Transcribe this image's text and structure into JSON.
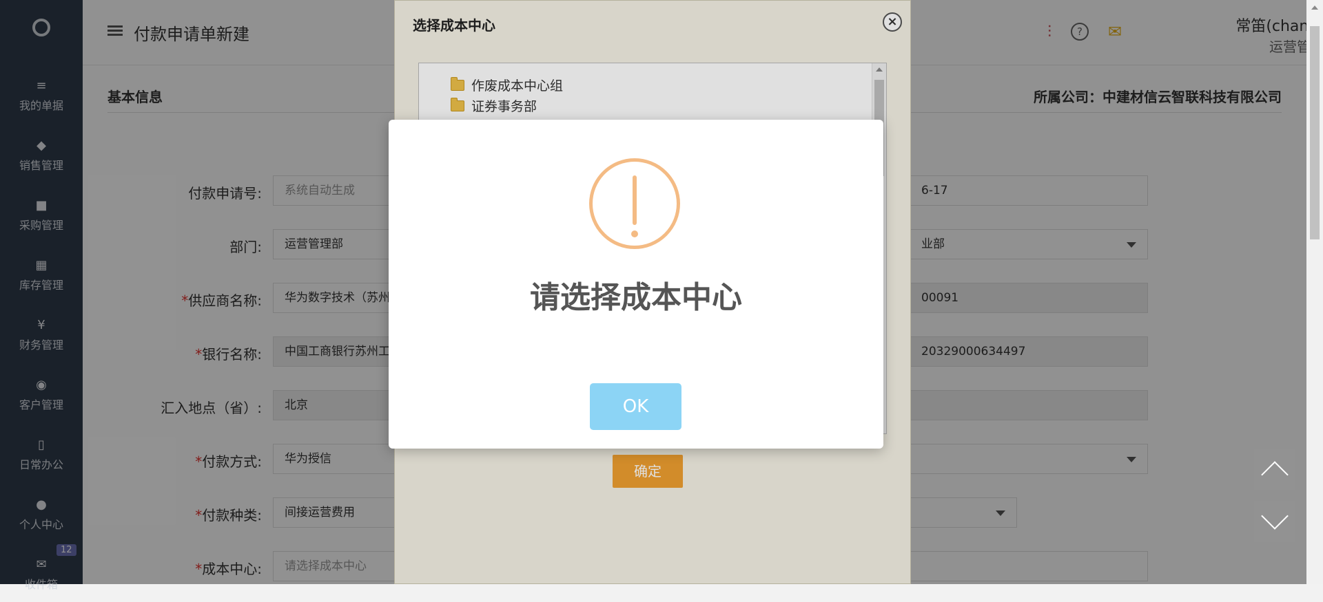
{
  "sidebar": {
    "items": [
      {
        "label": "我的单据",
        "icon": "documents-icon"
      },
      {
        "label": "销售管理",
        "icon": "tag-icon"
      },
      {
        "label": "采购管理",
        "icon": "truck-icon"
      },
      {
        "label": "库存管理",
        "icon": "grid-icon"
      },
      {
        "label": "财务管理",
        "icon": "yen-icon"
      },
      {
        "label": "客户管理",
        "icon": "target-icon"
      },
      {
        "label": "日常办公",
        "icon": "office-icon"
      },
      {
        "label": "个人中心",
        "icon": "user-icon"
      },
      {
        "label": "收件箱",
        "icon": "mail-icon"
      }
    ],
    "inbox_badge": "12"
  },
  "header": {
    "title": "付款申请单新建",
    "user_name": "常笛(changdi)",
    "user_dept": "运营管理部"
  },
  "form": {
    "section_title": "基本信息",
    "company": "所属公司：中建材信云智联科技有限公司",
    "rows": [
      {
        "label": "付款申请号:",
        "required": false,
        "left_value": "系统自动生成",
        "right_value": "6-17"
      },
      {
        "label": "部门:",
        "required": false,
        "left_value": "运营管理部",
        "right_value": "业部"
      },
      {
        "label": "供应商名称:",
        "required": true,
        "left_value": "华为数字技术（苏州",
        "right_value": "00091"
      },
      {
        "label": "银行名称:",
        "required": true,
        "left_value": "中国工商银行苏州工",
        "right_value": "20329000634497"
      },
      {
        "label": "汇入地点（省）:",
        "required": false,
        "left_value": "北京",
        "right_value": ""
      },
      {
        "label": "付款方式:",
        "required": true,
        "left_value": "华为授信",
        "right_value": ""
      },
      {
        "label": "付款种类:",
        "required": true,
        "left_value": "间接运营费用",
        "right_value": ""
      },
      {
        "label": "成本中心:",
        "required": true,
        "left_value": "请选择成本中心",
        "right_value": ""
      }
    ]
  },
  "dialog": {
    "title": "选择成本中心",
    "tree_items": [
      "作废成本中心组",
      "证券事务部"
    ],
    "confirm_label": "确定"
  },
  "alert": {
    "message": "请选择成本中心",
    "ok_label": "OK",
    "accent": "#f4bb84",
    "ok_color": "#8cd4f5"
  }
}
